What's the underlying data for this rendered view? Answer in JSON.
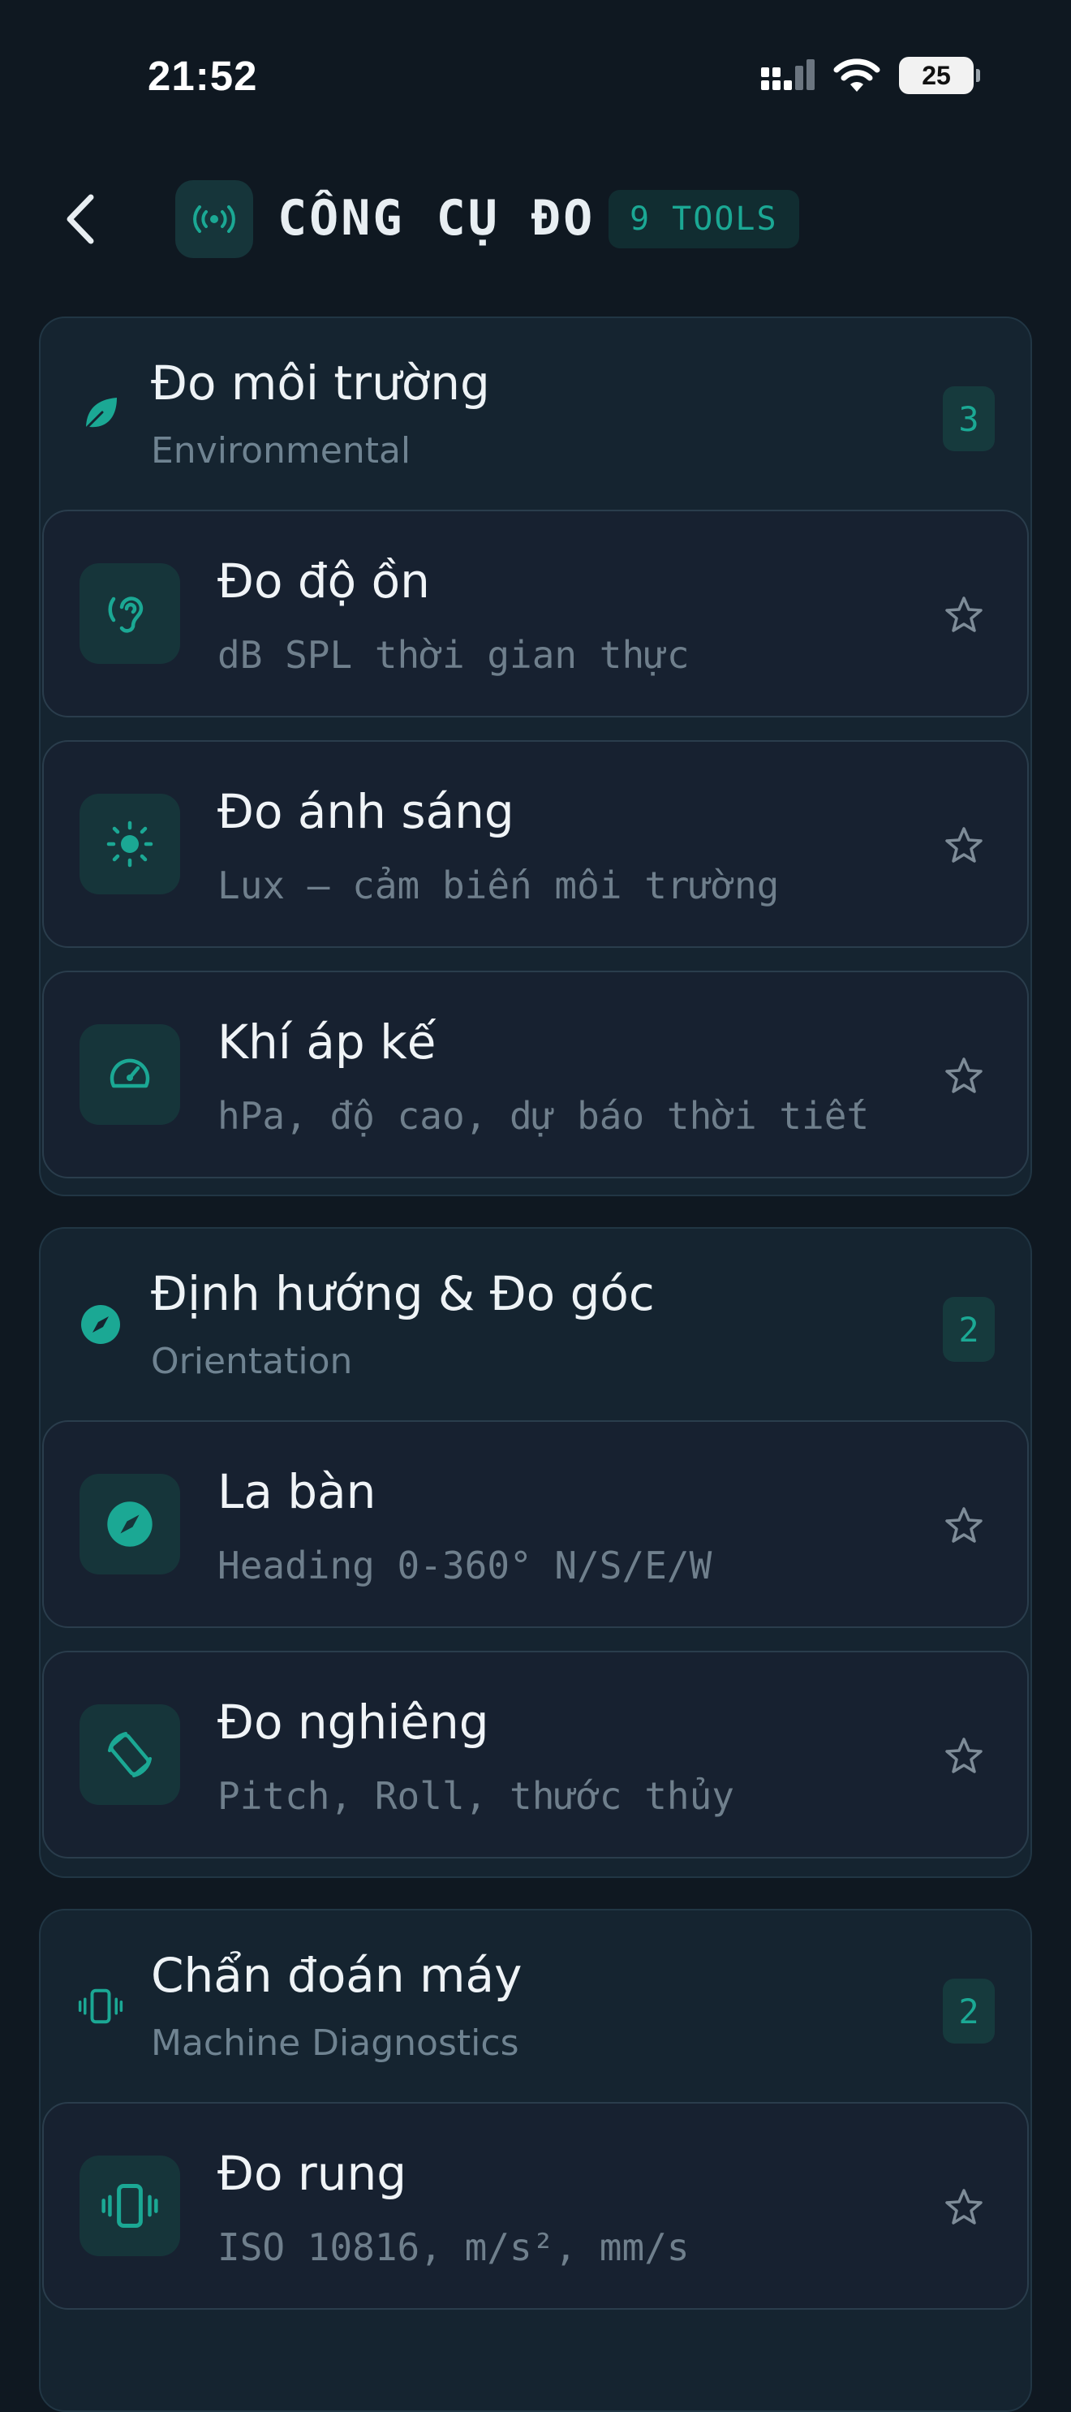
{
  "status": {
    "time": "21:52",
    "battery": "25"
  },
  "header": {
    "title": "CÔNG CỤ ĐO",
    "badge": "9 TOOLS"
  },
  "groups": [
    {
      "title": "Đo môi trường",
      "subtitle": "Environmental",
      "count": "3",
      "tools": [
        {
          "title": "Đo độ ồn",
          "desc": "dB SPL thời gian thực"
        },
        {
          "title": "Đo ánh sáng",
          "desc": "Lux — cảm biến môi trường"
        },
        {
          "title": "Khí áp kế",
          "desc": "hPa, độ cao, dự báo thời tiết"
        }
      ]
    },
    {
      "title": "Định hướng & Đo góc",
      "subtitle": "Orientation",
      "count": "2",
      "tools": [
        {
          "title": "La bàn",
          "desc": "Heading 0-360° N/S/E/W"
        },
        {
          "title": "Đo nghiêng",
          "desc": "Pitch, Roll, thước thủy"
        }
      ]
    },
    {
      "title": "Chẩn đoán máy",
      "subtitle": "Machine Diagnostics",
      "count": "2",
      "tools": [
        {
          "title": "Đo rung",
          "desc": "ISO 10816, m/s², mm/s"
        }
      ]
    }
  ],
  "colors": {
    "accent": "#1ba894",
    "background": "#0f1821",
    "card": "#172130"
  }
}
